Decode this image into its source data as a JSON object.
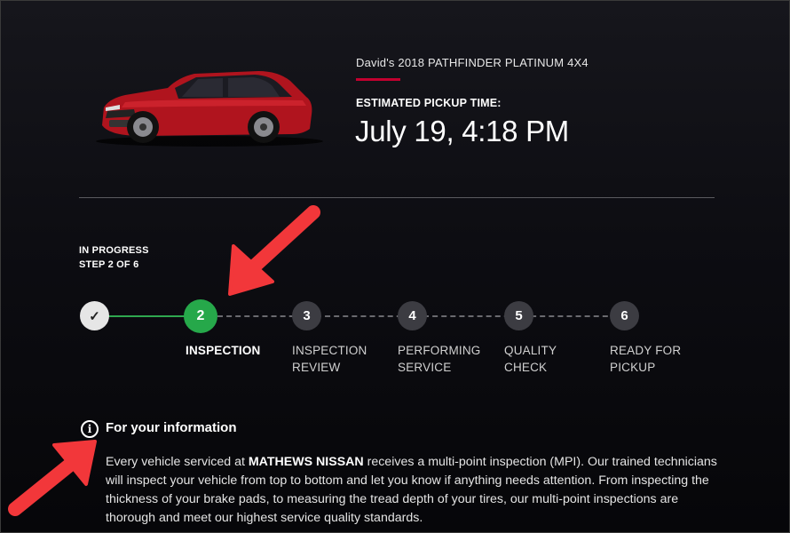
{
  "vehicle": {
    "name": "David's 2018 PATHFINDER PLATINUM 4X4",
    "image_icon": "red-suv-car-image",
    "accent_color": "#c3002f"
  },
  "pickup": {
    "label": "ESTIMATED PICKUP TIME:",
    "time": "July 19, 4:18 PM"
  },
  "status": {
    "state": "IN PROGRESS",
    "step_text": "STEP 2 OF 6"
  },
  "steps": [
    {
      "number": "1",
      "icon": "check-icon",
      "label": "",
      "state": "done"
    },
    {
      "number": "2",
      "label": "INSPECTION",
      "state": "current"
    },
    {
      "number": "3",
      "label_lines": [
        "INSPECTION",
        "REVIEW"
      ],
      "state": "pending"
    },
    {
      "number": "4",
      "label_lines": [
        "PERFORMING",
        "SERVICE"
      ],
      "state": "pending"
    },
    {
      "number": "5",
      "label_lines": [
        "QUALITY",
        "CHECK"
      ],
      "state": "pending"
    },
    {
      "number": "6",
      "label_lines": [
        "READY FOR",
        "PICKUP"
      ],
      "state": "pending"
    }
  ],
  "step_colors": {
    "done": "#e6e6e6",
    "current": "#26a84a",
    "pending": "#3c3c42"
  },
  "info": {
    "icon": "info-icon",
    "title": "For your information",
    "body_prefix": "Every vehicle serviced at ",
    "dealer": "MATHEWS NISSAN",
    "body_suffix": " receives a multi-point inspection (MPI). Our trained technicians will inspect your vehicle from top to bottom and let you know if anything needs attention. From inspecting the thickness of your brake pads, to measuring the tread depth of your tires, our multi-point inspections are thorough and meet our highest service quality standards."
  },
  "annotations": {
    "arrow_color": "#f2373a"
  }
}
